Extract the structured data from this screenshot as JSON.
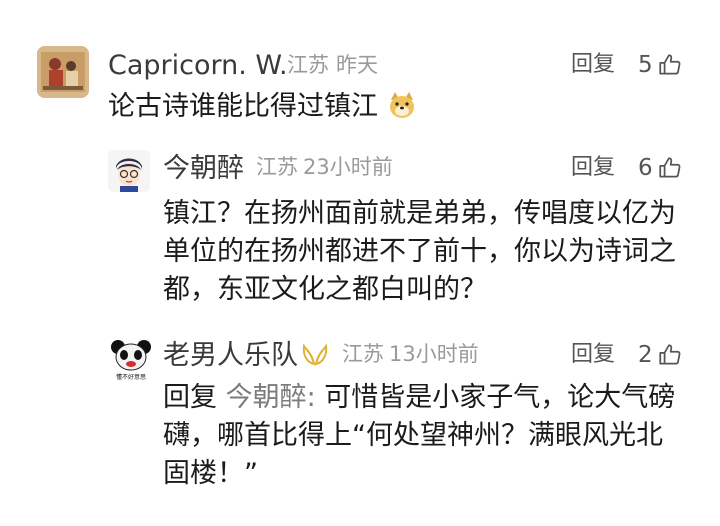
{
  "comments": [
    {
      "username": "Capricorn. W.",
      "location": "江苏",
      "time": "昨天",
      "reply_label": "回复",
      "likes": "5",
      "text": "论古诗谁能比得过镇江",
      "avatar_icon": "painting-avatar",
      "emoji_icon": "doge-emoji-icon"
    },
    {
      "username": "今朝醉",
      "location": "江苏",
      "time": "23小时前",
      "reply_label": "回复",
      "likes": "6",
      "text": "镇江？在扬州面前就是弟弟，传唱度以亿为单位的在扬州都进不了前十，你以为诗词之都，东亚文化之都白叫的？",
      "avatar_icon": "cartoon-boy-avatar"
    },
    {
      "username": "老男人乐队",
      "location": "江苏",
      "time": "13小时前",
      "reply_label": "回复",
      "likes": "2",
      "reply_prefix": "回复",
      "reply_target": "今朝醉:",
      "text": "可惜皆是小家子气，论大气磅礴，哪首比得上“何处望神州？满眼风光北固楼！”",
      "avatar_icon": "panda-meme-avatar",
      "avatar_caption": "懂不好意思",
      "badge_icon": "wings-badge-icon"
    }
  ],
  "colors": {
    "meta": "#9a9a9a",
    "text": "#1b1b1b",
    "reply_target": "#7c7c7c"
  }
}
